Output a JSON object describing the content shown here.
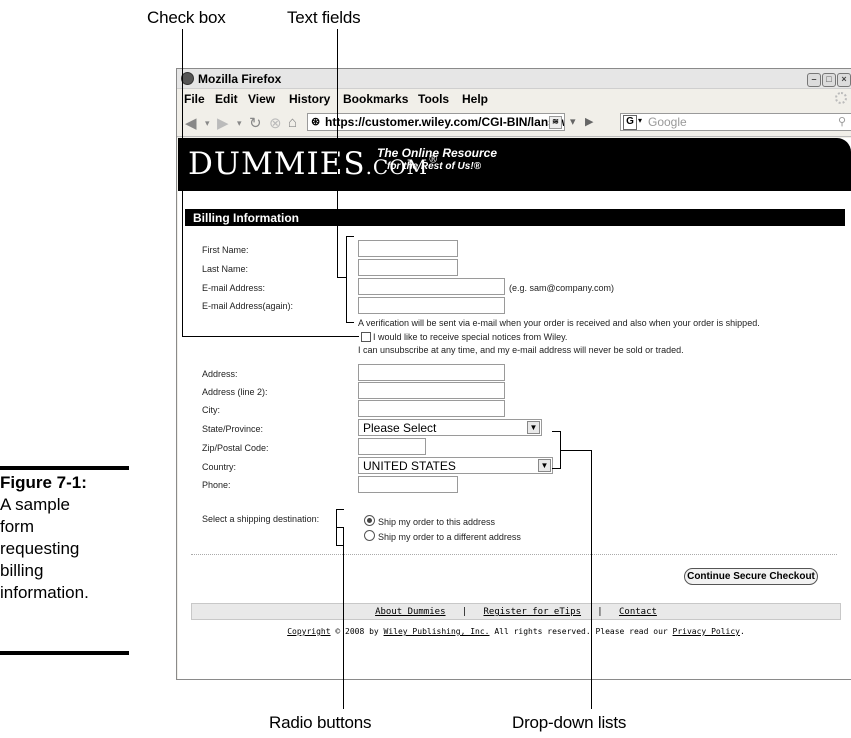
{
  "callouts": {
    "check_box": "Check box",
    "text_fields": "Text fields",
    "radio_buttons": "Radio buttons",
    "dropdown_lists": "Drop-down lists"
  },
  "caption": {
    "figure": "Figure 7-1:",
    "lines": [
      "A sample",
      "form",
      "requesting",
      "billing",
      "information."
    ]
  },
  "browser": {
    "title": "Mozilla Firefox",
    "menu": [
      "File",
      "Edit",
      "View",
      "History",
      "Bookmarks",
      "Tools",
      "Help"
    ],
    "url": "https://customer.wiley.com/CGI-BIN/lansaweb",
    "search_placeholder": "Google",
    "search_engine_letter": "G"
  },
  "site": {
    "logo": "DUMMIES",
    "logo_suffix": ".COM",
    "logo_reg": "®",
    "tagline1": "The Online Resource",
    "tagline2": "for the Rest of Us!®"
  },
  "form": {
    "section_title": "Billing Information",
    "labels": {
      "first_name": "First Name:",
      "last_name": "Last Name:",
      "email": "E-mail Address:",
      "email_again": "E-mail Address(again):",
      "address": "Address:",
      "address2": "Address (line 2):",
      "city": "City:",
      "state": "State/Province:",
      "zip": "Zip/Postal Code:",
      "country": "Country:",
      "phone": "Phone:",
      "shipping": "Select a shipping destination:"
    },
    "values": {
      "first_name": "",
      "last_name": "",
      "email": "",
      "email_again": "",
      "address": "",
      "address2": "",
      "city": "",
      "zip": "",
      "phone": ""
    },
    "email_hint": "(e.g. sam@company.com)",
    "verification_note": "A verification will be sent via e-mail when your order is received and also when your order is shipped.",
    "notices_label": "I would like to receive special notices from Wiley.",
    "notices_checked": false,
    "unsubscribe_note": "I can unsubscribe at any time, and my e-mail address will never be sold or traded.",
    "state_selected": "Please Select",
    "country_selected": "UNITED STATES",
    "shipping_options": [
      {
        "label": "Ship my order to this address",
        "selected": true
      },
      {
        "label": "Ship my order to a different address",
        "selected": false
      }
    ],
    "continue_button": "Continue Secure Checkout"
  },
  "footer": {
    "about": "About Dummies",
    "sep1": "|",
    "register": "Register for eTips",
    "sep2": "|",
    "contact": "Contact",
    "copyright": "Copyright",
    "copy_mid1": " © 2008 by ",
    "publisher": "Wiley Publishing, Inc.",
    "copy_mid2": " All rights reserved. Please read our ",
    "privacy": "Privacy Policy",
    "copy_end": "."
  }
}
